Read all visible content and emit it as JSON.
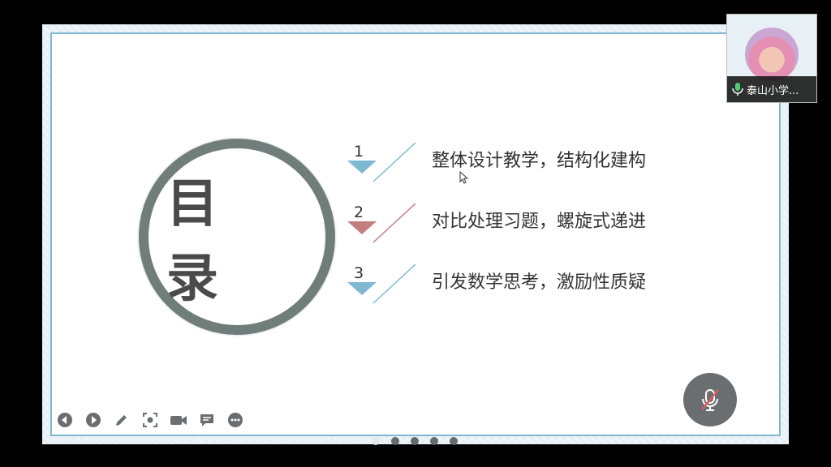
{
  "slide": {
    "title": "目 录",
    "items": [
      {
        "number": "1",
        "text": "整体设计教学，结构化建构"
      },
      {
        "number": "2",
        "text": "对比处理习题，螺旋式递进"
      },
      {
        "number": "3",
        "text": "引发数学思考，激励性质疑"
      }
    ]
  },
  "participant": {
    "name": "泰山小学..."
  },
  "toolbar": {
    "icons": [
      "prev-icon",
      "next-icon",
      "pen-icon",
      "screenshot-icon",
      "video-icon",
      "chat-icon",
      "more-icon"
    ]
  },
  "pager": {
    "count": 5,
    "active_index": 0
  },
  "colors": {
    "accent_blue": "#7fb9d1",
    "accent_red": "#c27e80",
    "ring": "#6f7e7a",
    "mic_off": "#e05a5a"
  }
}
